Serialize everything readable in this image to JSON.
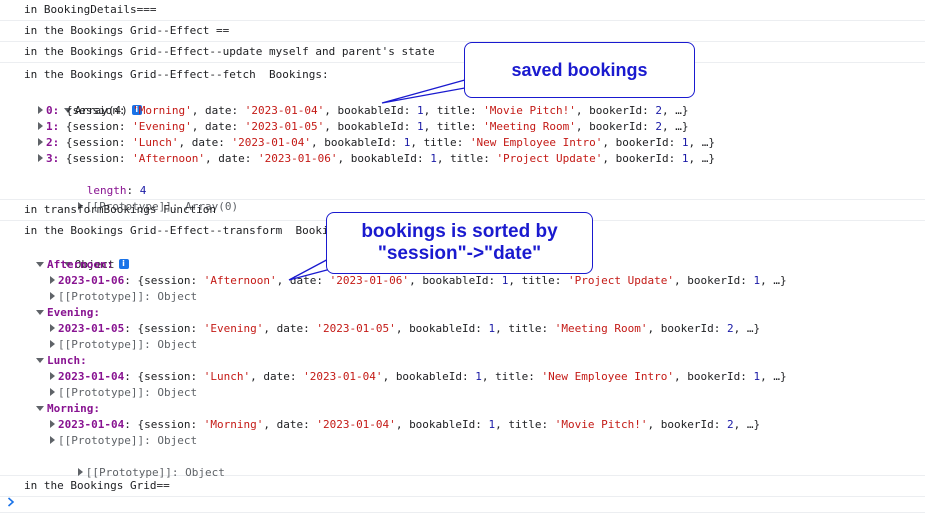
{
  "console": {
    "messages": [
      {
        "text": "in BookingDetails==="
      },
      {
        "text": "in the Bookings Grid--Effect =="
      },
      {
        "text": "in the Bookings Grid--Effect--update myself and parent's state"
      },
      {
        "text": "in the Bookings Grid--Effect--fetch  Bookings:"
      }
    ],
    "array_group": {
      "label": "Array(4)",
      "info_glyph": "i",
      "items": [
        {
          "index": "0: ",
          "session": "'Morning'",
          "date": "'2023-01-04'",
          "bookableId": "1",
          "title": "'Movie Pitch!'",
          "bookerId": "2"
        },
        {
          "index": "1: ",
          "session": "'Evening'",
          "date": "'2023-01-05'",
          "bookableId": "1",
          "title": "'Meeting Room'",
          "bookerId": "2"
        },
        {
          "index": "2: ",
          "session": "'Lunch'",
          "date": "'2023-01-04'",
          "bookableId": "1",
          "title": "'New Employee Intro'",
          "bookerId": "1"
        },
        {
          "index": "3: ",
          "session": "'Afternoon'",
          "date": "'2023-01-06'",
          "bookableId": "1",
          "title": "'Project Update'",
          "bookerId": "1"
        }
      ],
      "length_key": "length",
      "length_value": "4",
      "prototype": "[[Prototype]]: Array(0)"
    },
    "msg_transform_fn": "in transformBookings Function",
    "msg_transform": "in the Bookings Grid--Effect--transform  Booki",
    "object_group": {
      "label": "Object",
      "info_glyph": "i",
      "groups": [
        {
          "key": "Afternoon:",
          "date_key": "2023-01-06",
          "session": "'Afternoon'",
          "date": "'2023-01-06'",
          "bookableId": "1",
          "title": "'Project Update'",
          "bookerId": "1"
        },
        {
          "key": "Evening:",
          "date_key": "2023-01-05",
          "session": "'Evening'",
          "date": "'2023-01-05'",
          "bookableId": "1",
          "title": "'Meeting Room'",
          "bookerId": "2"
        },
        {
          "key": "Lunch:",
          "date_key": "2023-01-04",
          "session": "'Lunch'",
          "date": "'2023-01-04'",
          "bookableId": "1",
          "title": "'New Employee Intro'",
          "bookerId": "1"
        },
        {
          "key": "Morning:",
          "date_key": "2023-01-04",
          "session": "'Morning'",
          "date": "'2023-01-04'",
          "bookableId": "1",
          "title": "'Movie Pitch!'",
          "bookerId": "2"
        }
      ],
      "inner_prototype": "[[Prototype]]: Object",
      "prototype": "[[Prototype]]: Object"
    },
    "last_message": "in the Bookings Grid==",
    "prompt_glyph": "›"
  },
  "syntax": {
    "open": "{",
    "session_key": "session",
    "date_key": "date",
    "bookableId_key": "bookableId",
    "title_key": "title",
    "bookerId_key": "bookerId",
    "colon": ": ",
    "comma": ", ",
    "ellipsis": "…}"
  },
  "annotations": {
    "saved": "saved bookings",
    "sorted_line1": "bookings is sorted by",
    "sorted_line2": "\"session\"->\"date\""
  },
  "colors": {
    "property_key": "#881391",
    "string": "#c41a16",
    "number": "#1a1aa6",
    "callout": "#1a1acf",
    "info_badge": "#1a73e8"
  }
}
